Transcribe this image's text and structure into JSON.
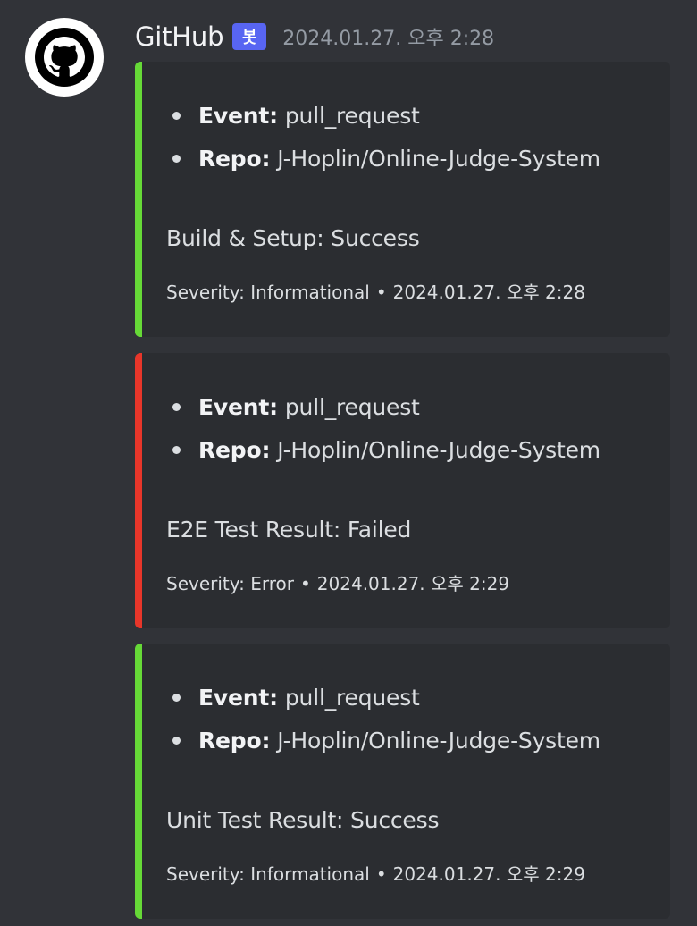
{
  "author": {
    "name": "GitHub",
    "bot_tag": "봇",
    "timestamp": "2024.01.27. 오후 2:28",
    "avatar_icon": "github-logo-icon"
  },
  "colors": {
    "success": "#66d937",
    "error": "#e8362a",
    "embed_bg": "#2b2d31",
    "page_bg": "#313338",
    "bot_tag": "#5865f2"
  },
  "embeds": [
    {
      "status": "success",
      "event_label": "Event:",
      "event_value": "pull_request",
      "repo_label": "Repo:",
      "repo_value": "J-Hoplin/Online-Judge-System",
      "result": "Build & Setup: Success",
      "severity": "Severity: Informational",
      "separator": "•",
      "timestamp": "2024.01.27. 오후 2:28"
    },
    {
      "status": "error",
      "event_label": "Event:",
      "event_value": "pull_request",
      "repo_label": "Repo:",
      "repo_value": "J-Hoplin/Online-Judge-System",
      "result": "E2E Test Result: Failed",
      "severity": "Severity: Error",
      "separator": "•",
      "timestamp": "2024.01.27. 오후 2:29"
    },
    {
      "status": "success",
      "event_label": "Event:",
      "event_value": "pull_request",
      "repo_label": "Repo:",
      "repo_value": "J-Hoplin/Online-Judge-System",
      "result": "Unit Test Result: Success",
      "severity": "Severity: Informational",
      "separator": "•",
      "timestamp": "2024.01.27. 오후 2:29"
    }
  ]
}
